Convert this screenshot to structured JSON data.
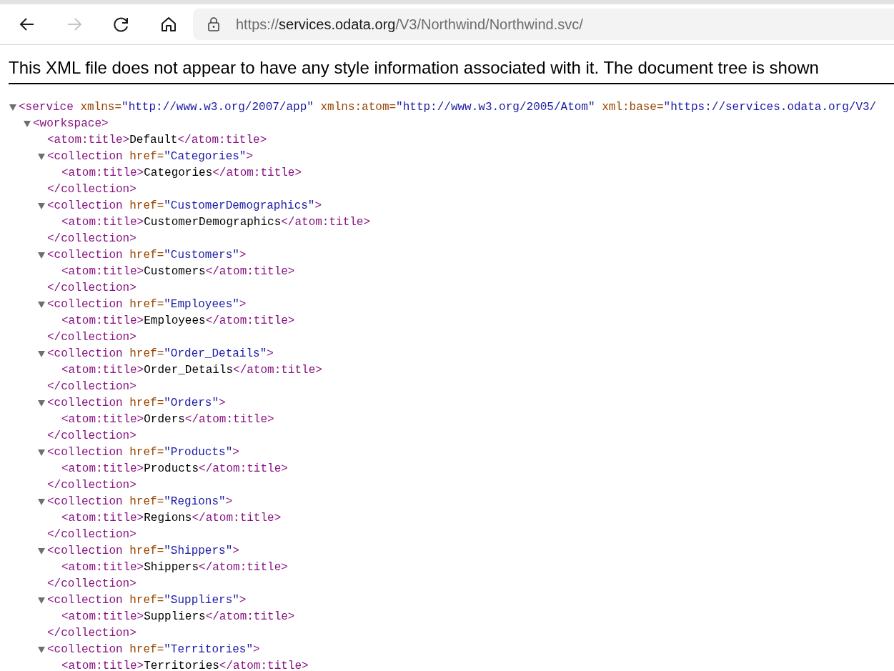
{
  "toolbar": {
    "forward": {
      "disabled": true
    },
    "address": [
      {
        "text": "https://",
        "host": false
      },
      {
        "text": "services.odata.org",
        "host": true
      },
      {
        "text": "/V3/Northwind/Northwind.svc/",
        "host": false
      }
    ]
  },
  "notice": "This XML file does not appear to have any style information associated with it. The document tree is shown",
  "tree": [
    {
      "expanded": true,
      "line": [
        {
          "kind": "tag",
          "text": "<service"
        },
        {
          "kind": "attr",
          "text": " xmlns="
        },
        {
          "kind": "value",
          "text": "\"http://www.w3.org/2007/app\""
        },
        {
          "kind": "attr",
          "text": " xmlns:atom="
        },
        {
          "kind": "value",
          "text": "\"http://www.w3.org/2005/Atom\""
        },
        {
          "kind": "attr",
          "text": " xml:base="
        },
        {
          "kind": "value",
          "text": "\"https://services.odata.org/V3/"
        }
      ],
      "children": [
        {
          "expanded": true,
          "line": [
            {
              "kind": "tag",
              "text": "<workspace>"
            }
          ],
          "children": [
            {
              "line": [
                {
                  "kind": "tag",
                  "text": "<atom:title>"
                },
                {
                  "kind": "text",
                  "text": "Default"
                },
                {
                  "kind": "tag",
                  "text": "</atom:title>"
                }
              ]
            },
            {
              "expanded": true,
              "line": [
                {
                  "kind": "tag",
                  "text": "<collection"
                },
                {
                  "kind": "attr",
                  "text": " href="
                },
                {
                  "kind": "value",
                  "text": "\"Categories\""
                },
                {
                  "kind": "tag",
                  "text": ">"
                }
              ],
              "children": [
                {
                  "line": [
                    {
                      "kind": "tag",
                      "text": "<atom:title>"
                    },
                    {
                      "kind": "text",
                      "text": "Categories"
                    },
                    {
                      "kind": "tag",
                      "text": "</atom:title>"
                    }
                  ]
                }
              ],
              "close": [
                {
                  "kind": "tag",
                  "text": "</collection>"
                }
              ]
            },
            {
              "expanded": true,
              "line": [
                {
                  "kind": "tag",
                  "text": "<collection"
                },
                {
                  "kind": "attr",
                  "text": " href="
                },
                {
                  "kind": "value",
                  "text": "\"CustomerDemographics\""
                },
                {
                  "kind": "tag",
                  "text": ">"
                }
              ],
              "children": [
                {
                  "line": [
                    {
                      "kind": "tag",
                      "text": "<atom:title>"
                    },
                    {
                      "kind": "text",
                      "text": "CustomerDemographics"
                    },
                    {
                      "kind": "tag",
                      "text": "</atom:title>"
                    }
                  ]
                }
              ],
              "close": [
                {
                  "kind": "tag",
                  "text": "</collection>"
                }
              ]
            },
            {
              "expanded": true,
              "line": [
                {
                  "kind": "tag",
                  "text": "<collection"
                },
                {
                  "kind": "attr",
                  "text": " href="
                },
                {
                  "kind": "value",
                  "text": "\"Customers\""
                },
                {
                  "kind": "tag",
                  "text": ">"
                }
              ],
              "children": [
                {
                  "line": [
                    {
                      "kind": "tag",
                      "text": "<atom:title>"
                    },
                    {
                      "kind": "text",
                      "text": "Customers"
                    },
                    {
                      "kind": "tag",
                      "text": "</atom:title>"
                    }
                  ]
                }
              ],
              "close": [
                {
                  "kind": "tag",
                  "text": "</collection>"
                }
              ]
            },
            {
              "expanded": true,
              "line": [
                {
                  "kind": "tag",
                  "text": "<collection"
                },
                {
                  "kind": "attr",
                  "text": " href="
                },
                {
                  "kind": "value",
                  "text": "\"Employees\""
                },
                {
                  "kind": "tag",
                  "text": ">"
                }
              ],
              "children": [
                {
                  "line": [
                    {
                      "kind": "tag",
                      "text": "<atom:title>"
                    },
                    {
                      "kind": "text",
                      "text": "Employees"
                    },
                    {
                      "kind": "tag",
                      "text": "</atom:title>"
                    }
                  ]
                }
              ],
              "close": [
                {
                  "kind": "tag",
                  "text": "</collection>"
                }
              ]
            },
            {
              "expanded": true,
              "line": [
                {
                  "kind": "tag",
                  "text": "<collection"
                },
                {
                  "kind": "attr",
                  "text": " href="
                },
                {
                  "kind": "value",
                  "text": "\"Order_Details\""
                },
                {
                  "kind": "tag",
                  "text": ">"
                }
              ],
              "children": [
                {
                  "line": [
                    {
                      "kind": "tag",
                      "text": "<atom:title>"
                    },
                    {
                      "kind": "text",
                      "text": "Order_Details"
                    },
                    {
                      "kind": "tag",
                      "text": "</atom:title>"
                    }
                  ]
                }
              ],
              "close": [
                {
                  "kind": "tag",
                  "text": "</collection>"
                }
              ]
            },
            {
              "expanded": true,
              "line": [
                {
                  "kind": "tag",
                  "text": "<collection"
                },
                {
                  "kind": "attr",
                  "text": " href="
                },
                {
                  "kind": "value",
                  "text": "\"Orders\""
                },
                {
                  "kind": "tag",
                  "text": ">"
                }
              ],
              "children": [
                {
                  "line": [
                    {
                      "kind": "tag",
                      "text": "<atom:title>"
                    },
                    {
                      "kind": "text",
                      "text": "Orders"
                    },
                    {
                      "kind": "tag",
                      "text": "</atom:title>"
                    }
                  ]
                }
              ],
              "close": [
                {
                  "kind": "tag",
                  "text": "</collection>"
                }
              ]
            },
            {
              "expanded": true,
              "line": [
                {
                  "kind": "tag",
                  "text": "<collection"
                },
                {
                  "kind": "attr",
                  "text": " href="
                },
                {
                  "kind": "value",
                  "text": "\"Products\""
                },
                {
                  "kind": "tag",
                  "text": ">"
                }
              ],
              "children": [
                {
                  "line": [
                    {
                      "kind": "tag",
                      "text": "<atom:title>"
                    },
                    {
                      "kind": "text",
                      "text": "Products"
                    },
                    {
                      "kind": "tag",
                      "text": "</atom:title>"
                    }
                  ]
                }
              ],
              "close": [
                {
                  "kind": "tag",
                  "text": "</collection>"
                }
              ]
            },
            {
              "expanded": true,
              "line": [
                {
                  "kind": "tag",
                  "text": "<collection"
                },
                {
                  "kind": "attr",
                  "text": " href="
                },
                {
                  "kind": "value",
                  "text": "\"Regions\""
                },
                {
                  "kind": "tag",
                  "text": ">"
                }
              ],
              "children": [
                {
                  "line": [
                    {
                      "kind": "tag",
                      "text": "<atom:title>"
                    },
                    {
                      "kind": "text",
                      "text": "Regions"
                    },
                    {
                      "kind": "tag",
                      "text": "</atom:title>"
                    }
                  ]
                }
              ],
              "close": [
                {
                  "kind": "tag",
                  "text": "</collection>"
                }
              ]
            },
            {
              "expanded": true,
              "line": [
                {
                  "kind": "tag",
                  "text": "<collection"
                },
                {
                  "kind": "attr",
                  "text": " href="
                },
                {
                  "kind": "value",
                  "text": "\"Shippers\""
                },
                {
                  "kind": "tag",
                  "text": ">"
                }
              ],
              "children": [
                {
                  "line": [
                    {
                      "kind": "tag",
                      "text": "<atom:title>"
                    },
                    {
                      "kind": "text",
                      "text": "Shippers"
                    },
                    {
                      "kind": "tag",
                      "text": "</atom:title>"
                    }
                  ]
                }
              ],
              "close": [
                {
                  "kind": "tag",
                  "text": "</collection>"
                }
              ]
            },
            {
              "expanded": true,
              "line": [
                {
                  "kind": "tag",
                  "text": "<collection"
                },
                {
                  "kind": "attr",
                  "text": " href="
                },
                {
                  "kind": "value",
                  "text": "\"Suppliers\""
                },
                {
                  "kind": "tag",
                  "text": ">"
                }
              ],
              "children": [
                {
                  "line": [
                    {
                      "kind": "tag",
                      "text": "<atom:title>"
                    },
                    {
                      "kind": "text",
                      "text": "Suppliers"
                    },
                    {
                      "kind": "tag",
                      "text": "</atom:title>"
                    }
                  ]
                }
              ],
              "close": [
                {
                  "kind": "tag",
                  "text": "</collection>"
                }
              ]
            },
            {
              "expanded": true,
              "line": [
                {
                  "kind": "tag",
                  "text": "<collection"
                },
                {
                  "kind": "attr",
                  "text": " href="
                },
                {
                  "kind": "value",
                  "text": "\"Territories\""
                },
                {
                  "kind": "tag",
                  "text": ">"
                }
              ],
              "children": [
                {
                  "line": [
                    {
                      "kind": "tag",
                      "text": "<atom:title>"
                    },
                    {
                      "kind": "text",
                      "text": "Territories"
                    },
                    {
                      "kind": "tag",
                      "text": "</atom:title>"
                    }
                  ]
                }
              ]
            }
          ]
        }
      ]
    }
  ]
}
